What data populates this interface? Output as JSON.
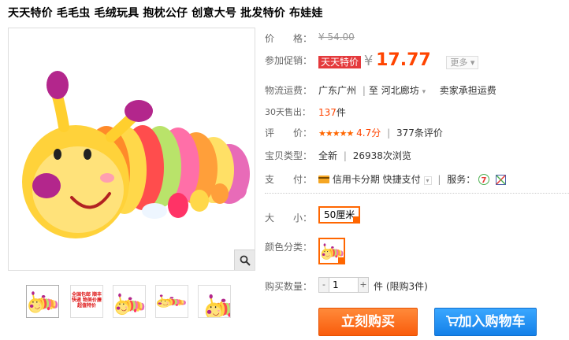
{
  "title": "天天特价 毛毛虫 毛绒玩具 抱枕公仔 创意大号 批发特价 布娃娃",
  "thumbnails": [
    {
      "name": "thumb-caterpillar-front"
    },
    {
      "name": "thumb-promo-text",
      "text": "全国包邮 顺丰快递 物美价廉 超值特价"
    },
    {
      "name": "thumb-caterpillar-side"
    },
    {
      "name": "thumb-caterpillar-long"
    },
    {
      "name": "thumb-caterpillar-head"
    }
  ],
  "price": {
    "label": "价　　格：",
    "original": "¥ 54.00"
  },
  "promo": {
    "label": "参加促销：",
    "tag": "天天特价",
    "yen": "¥",
    "price": "17.77",
    "more": "更多 ▾"
  },
  "shipping": {
    "label": "物流运费：",
    "from": "广东广州",
    "sep": "|",
    "to_prefix": "至",
    "to": "河北廊坊",
    "caret": "▾",
    "fee": "卖家承担运费"
  },
  "sales": {
    "label": "30天售出：",
    "count": "137",
    "unit": "件"
  },
  "rating": {
    "label": "评　　价：",
    "stars": "★★★★★",
    "score": "4.7分",
    "sep": "|",
    "reviews": "377条评价"
  },
  "item_type": {
    "label": "宝贝类型：",
    "type": "全新",
    "sep": "|",
    "views": "26938次浏览"
  },
  "payment": {
    "label": "支　　付：",
    "credit": "信用卡分期",
    "express": "快捷支付",
    "caret": "▾",
    "sep": "|",
    "service_label": "服务："
  },
  "size": {
    "label": "大　　小：",
    "option": "50厘米"
  },
  "color": {
    "label": "颜色分类："
  },
  "quantity": {
    "label": "购买数量：",
    "minus": "-",
    "value": "1",
    "plus": "+",
    "unit": "件",
    "limit": "(限购3件)"
  },
  "actions": {
    "buy": "立刻购买",
    "cart": "加入购物车"
  },
  "colors": {
    "accent": "#ff4400",
    "promo_red": "#e4393c",
    "buy_orange": "#f95c0c",
    "cart_blue": "#1480e8"
  }
}
